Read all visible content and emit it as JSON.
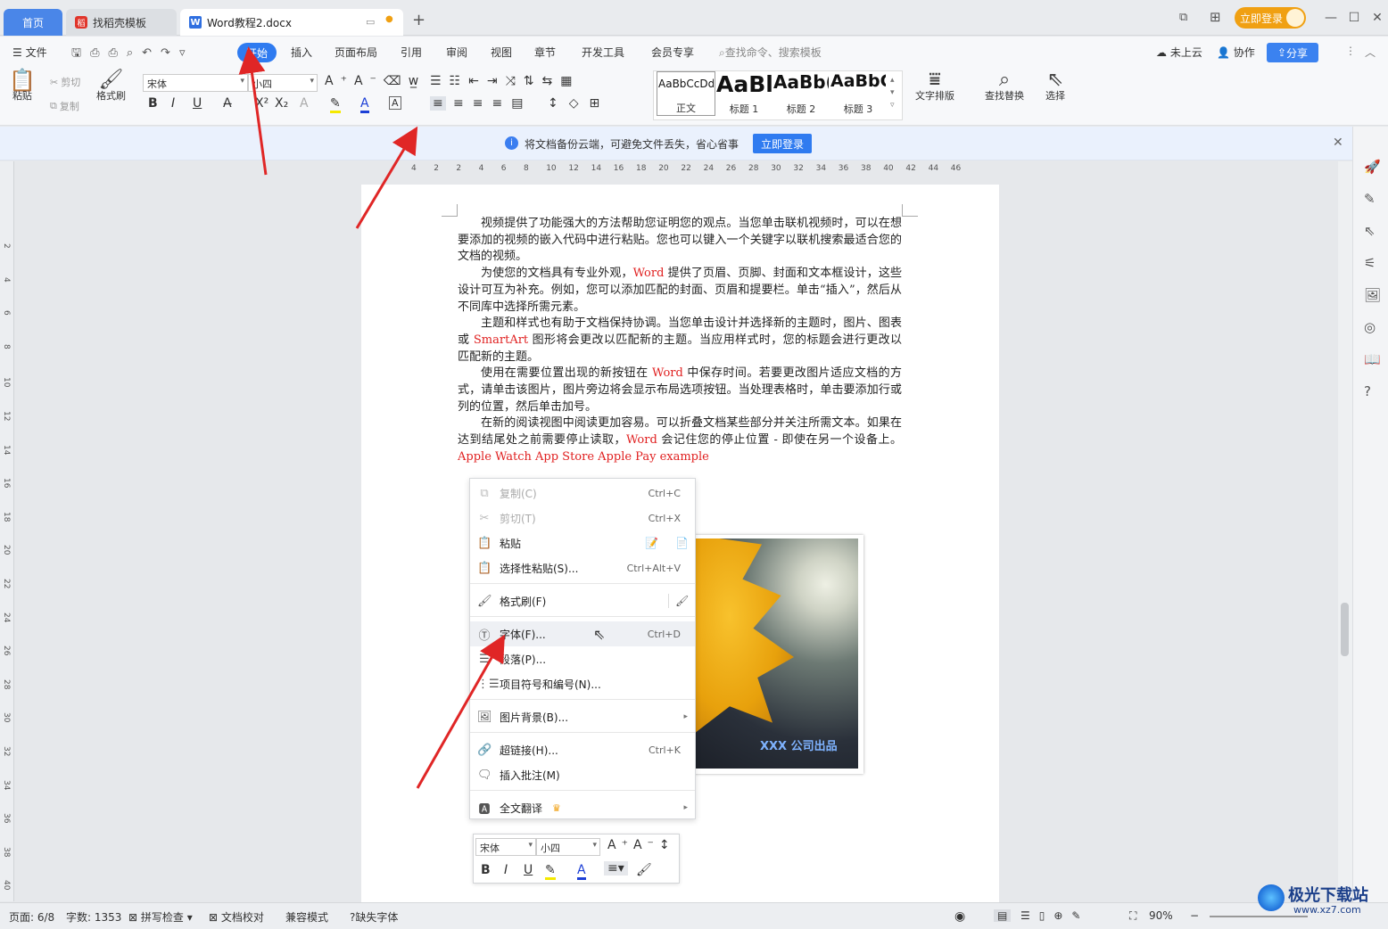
{
  "tabs": {
    "home": "首页",
    "template": "找稻壳模板",
    "doc": "Word教程2.docx"
  },
  "titlebar": {
    "login": "立即登录"
  },
  "menubar": {
    "file": "文件",
    "items": [
      "开始",
      "插入",
      "页面布局",
      "引用",
      "审阅",
      "视图",
      "章节",
      "开发工具",
      "会员专享"
    ],
    "search": "查找命令、搜索模板",
    "cloud": "未上云",
    "collab": "协作",
    "share": "分享"
  },
  "ribbon": {
    "paste": "粘贴",
    "cut": "剪切",
    "copy": "复制",
    "format_painter": "格式刷",
    "font": "宋体",
    "size": "小四",
    "styles": [
      {
        "sample": "AaBbCcDd",
        "label": "正文"
      },
      {
        "sample": "AaBl",
        "label": "标题 1"
      },
      {
        "sample": "AaBb(",
        "label": "标题 2"
      },
      {
        "sample": "AaBbC",
        "label": "标题 3"
      }
    ],
    "text_layout": "文字排版",
    "find_replace": "查找替换",
    "select": "选择"
  },
  "notice": {
    "text": "将文档备份云端，可避免文件丢失，省心省事",
    "button": "立即登录"
  },
  "ruler": {
    "ticks": [
      "4",
      "2",
      "2",
      "4",
      "6",
      "8",
      "10",
      "12",
      "14",
      "16",
      "18",
      "20",
      "22",
      "24",
      "26",
      "28",
      "30",
      "32",
      "34",
      "36",
      "38",
      "40",
      "42",
      "44",
      "46"
    ],
    "vticks": [
      "2",
      "4",
      "6",
      "8",
      "10",
      "12",
      "14",
      "16",
      "18",
      "20",
      "22",
      "24",
      "26",
      "28",
      "30",
      "32",
      "34",
      "36",
      "38",
      "40"
    ]
  },
  "document": {
    "paragraphs": [
      {
        "parts": [
          {
            "t": "视频提供了功能强大的方法帮助您证明您的观点。当您单击联机视频时，可以在想要添加的视频的嵌入代码中进行粘贴。您也可以键入一个关键字以联机搜索最适合您的文档的视频。",
            "red": false
          }
        ]
      },
      {
        "parts": [
          {
            "t": "为使您的文档具有专业外观，",
            "red": false
          },
          {
            "t": "Word",
            "red": true
          },
          {
            "t": " 提供了页眉、页脚、封面和文本框设计，这些设计可互为补充。例如，您可以添加匹配的封面、页眉和提要栏。单击“插入”，然后从不同库中选择所需元素。",
            "red": false
          }
        ]
      },
      {
        "parts": [
          {
            "t": "主题和样式也有助于文档保持协调。当您单击设计并选择新的主题时，图片、图表或 ",
            "red": false
          },
          {
            "t": "SmartArt",
            "red": true
          },
          {
            "t": " 图形将会更改以匹配新的主题。当应用样式时，您的标题会进行更改以匹配新的主题。",
            "red": false
          }
        ]
      },
      {
        "parts": [
          {
            "t": "使用在需要位置出现的新按钮在 ",
            "red": false
          },
          {
            "t": "Word",
            "red": true
          },
          {
            "t": " 中保存时间。若要更改图片适应文档的方式，请单击该图片，图片旁边将会显示布局选项按钮。当处理表格时，单击要添加行或列的位置，然后单击加号。",
            "red": false
          }
        ]
      },
      {
        "parts": [
          {
            "t": "在新的阅读视图中阅读更加容易。可以折叠文档某些部分并关注所需文本。如果在达到结尾处之前需要停止读取，",
            "red": false
          },
          {
            "t": "Word",
            "red": true
          },
          {
            "t": " 会记住您的停止位置 - 即使在另一个设备上。",
            "red": false
          },
          {
            "t": "Apple Watch   App Store   Apple Pay   example",
            "red": true
          }
        ]
      }
    ],
    "image_caption": "XXX 公司出品"
  },
  "context_menu": {
    "items": [
      {
        "label": "复制(C)",
        "shortcut": "Ctrl+C",
        "icon": "copy-icon",
        "disabled": true
      },
      {
        "label": "剪切(T)",
        "shortcut": "Ctrl+X",
        "icon": "scissors-icon",
        "disabled": true
      },
      {
        "label": "粘贴",
        "shortcut": "",
        "icon": "paste-icon",
        "disabled": false
      },
      {
        "label": "选择性粘贴(S)...",
        "shortcut": "Ctrl+Alt+V",
        "icon": "paste-special-icon",
        "disabled": false
      },
      {
        "label": "格式刷(F)",
        "shortcut": "",
        "icon": "brush-icon",
        "disabled": false
      },
      {
        "label": "字体(F)...",
        "shortcut": "Ctrl+D",
        "icon": "font-icon",
        "disabled": false
      },
      {
        "label": "段落(P)...",
        "shortcut": "",
        "icon": "paragraph-icon",
        "disabled": false
      },
      {
        "label": "项目符号和编号(N)...",
        "shortcut": "",
        "icon": "list-icon",
        "disabled": false
      },
      {
        "label": "图片背景(B)...",
        "shortcut": "",
        "icon": "image-icon",
        "disabled": false
      },
      {
        "label": "超链接(H)...",
        "shortcut": "Ctrl+K",
        "icon": "link-icon",
        "disabled": false
      },
      {
        "label": "插入批注(M)",
        "shortcut": "",
        "icon": "comment-icon",
        "disabled": false
      },
      {
        "label": "全文翻译",
        "shortcut": "",
        "icon": "translate-icon",
        "disabled": false
      }
    ]
  },
  "mini_toolbar": {
    "font": "宋体",
    "size": "小四"
  },
  "status": {
    "page": "页面: 6/8",
    "words": "字数: 1353",
    "spell": "拼写检查",
    "proof": "文档校对",
    "compat": "兼容模式",
    "missing_font": "缺失字体",
    "zoom": "90%"
  },
  "watermark": {
    "name": "极光下载站",
    "url": "www.xz7.com"
  },
  "colors": {
    "accent": "#2f7bf0",
    "red_text": "#e02020",
    "arrow": "#e02626"
  }
}
